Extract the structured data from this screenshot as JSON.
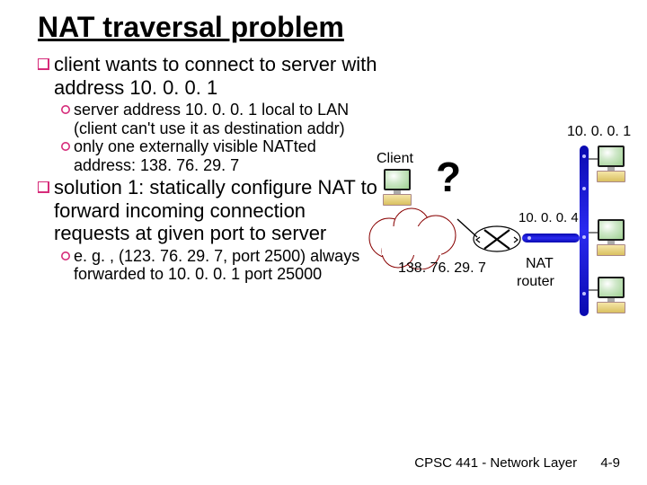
{
  "title": "NAT traversal problem",
  "bullets": {
    "b1_1": "client wants to connect to server with address 10. 0. 0. 1",
    "b1_1_sub": {
      "s1": "server address 10. 0. 0. 1 local to LAN (client can't use it as destination addr)",
      "s2": "only one externally visible NATted address: 138. 76. 29. 7"
    },
    "b1_2": "solution 1: statically configure NAT to forward incoming connection requests at given port to server",
    "b1_2_sub": {
      "s1": "e. g. , (123. 76. 29. 7, port 2500) always forwarded to 10. 0. 0. 1 port 25000"
    }
  },
  "diagram": {
    "client_label": "Client",
    "question_mark": "?",
    "server_addr": "10. 0. 0. 1",
    "internal_addr": "10. 0. 0. 4",
    "public_addr": "138. 76. 29. 7",
    "nat_label_1": "NAT",
    "nat_label_2": "router"
  },
  "footer": {
    "course": "CPSC 441 - Network Layer",
    "page": "4-9"
  }
}
